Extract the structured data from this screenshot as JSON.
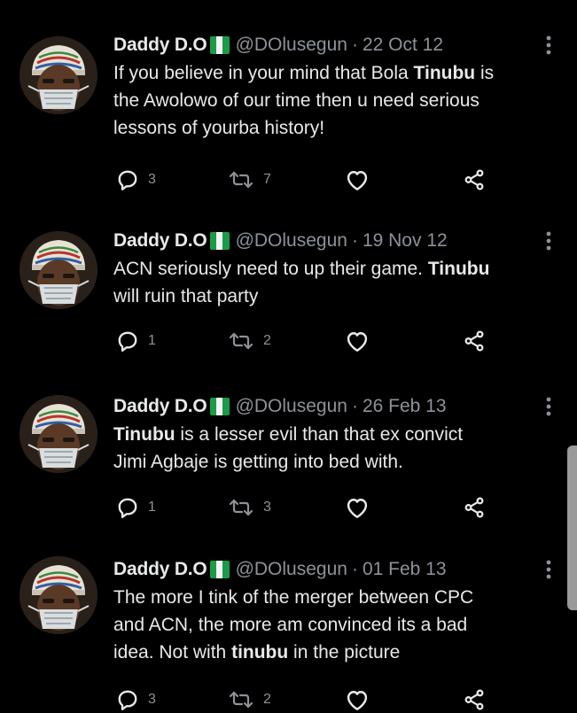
{
  "tweets": [
    {
      "name": "Daddy D.O",
      "flag": "nigeria-flag",
      "handle": "@DOlusegun",
      "separator": "·",
      "date": "22 Oct 12",
      "lines": [
        [
          {
            "t": "If you believe in your mind that Bola "
          },
          {
            "t": "Tinubu",
            "b": true
          },
          {
            "t": " is"
          }
        ],
        [
          {
            "t": "the Awolowo of our time then u need serious"
          }
        ],
        [
          {
            "t": "lessons of yourba history!"
          }
        ]
      ],
      "replies": "3",
      "retweets": "7"
    },
    {
      "name": "Daddy D.O",
      "flag": "nigeria-flag",
      "handle": "@DOlusegun",
      "separator": "·",
      "date": "19 Nov 12",
      "lines": [
        [
          {
            "t": "ACN seriously need to up their game. "
          },
          {
            "t": "Tinubu",
            "b": true
          }
        ],
        [
          {
            "t": "will ruin that party"
          }
        ]
      ],
      "replies": "1",
      "retweets": "2"
    },
    {
      "name": "Daddy D.O",
      "flag": "nigeria-flag",
      "handle": "@DOlusegun",
      "separator": "·",
      "date": "26 Feb 13",
      "lines": [
        [
          {
            "t": "Tinubu",
            "b": true
          },
          {
            "t": " is a lesser evil than that ex convict"
          }
        ],
        [
          {
            "t": "Jimi Agbaje is getting into bed with."
          }
        ]
      ],
      "replies": "1",
      "retweets": "3"
    },
    {
      "name": "Daddy D.O",
      "flag": "nigeria-flag",
      "handle": "@DOlusegun",
      "separator": "·",
      "date": "01 Feb 13",
      "lines": [
        [
          {
            "t": "The more I tink of the merger between CPC"
          }
        ],
        [
          {
            "t": "and ACN, the more am convinced its a bad"
          }
        ],
        [
          {
            "t": "idea. Not with "
          },
          {
            "t": "tinubu",
            "b": true
          },
          {
            "t": " in the picture"
          }
        ]
      ],
      "replies": "3",
      "retweets": "2"
    }
  ],
  "icons": {
    "reply": "reply-icon",
    "retweet": "retweet-icon",
    "like": "heart-icon",
    "share": "share-icon",
    "more": "more-vertical-icon"
  },
  "colors": {
    "background": "#000000",
    "text": "#e7e9ea",
    "muted": "#8b9299",
    "flag_green": "#1a9b48",
    "flag_white": "#f4f4f4"
  }
}
